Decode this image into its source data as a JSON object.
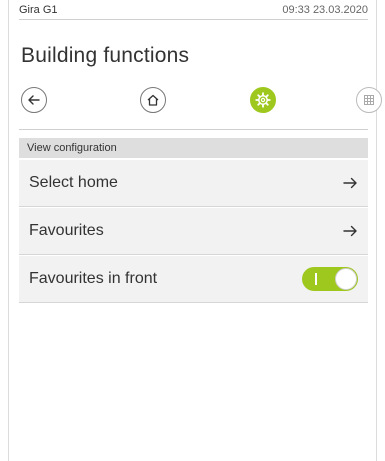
{
  "status_bar": {
    "device_name": "Gira G1",
    "datetime": "09:33 23.03.2020"
  },
  "page": {
    "title": "Building functions"
  },
  "nav": {
    "icons": [
      "back-arrow-icon",
      "home-icon",
      "settings-gear-icon",
      "grid-icon"
    ]
  },
  "section": {
    "header": "View configuration"
  },
  "rows": [
    {
      "label": "Select home",
      "control": "arrow-right-icon"
    },
    {
      "label": "Favourites",
      "control": "arrow-right-icon"
    },
    {
      "label": "Favourites in front",
      "control": "toggle",
      "toggle_on": true
    }
  ],
  "colors": {
    "accent": "#9ec81e",
    "row_bg": "#f2f2f2",
    "header_bg": "#dedede"
  }
}
